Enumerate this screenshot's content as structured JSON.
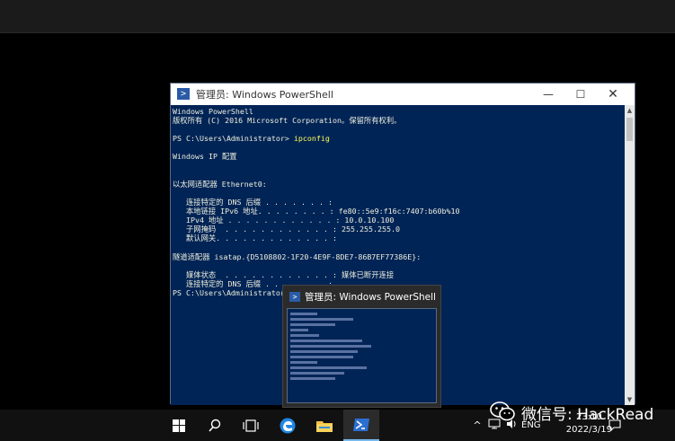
{
  "window": {
    "title": "管理员: Windows PowerShell",
    "minimize": "—",
    "maximize": "☐",
    "close": "✕",
    "icon": "powershell-icon"
  },
  "console": {
    "lines": [
      "Windows PowerShell",
      "版权所有 (C) 2016 Microsoft Corporation。保留所有权利。",
      "",
      "PS C:\\Users\\Administrator> ",
      "",
      "Windows IP 配置",
      "",
      "",
      "以太网适配器 Ethernet0:",
      "",
      "   连接特定的 DNS 后缀 . . . . . . . :",
      "   本地链接 IPv6 地址. . . . . . . . : fe80::5e9:f16c:7407:b60b%10",
      "   IPv4 地址 . . . . . . . . . . . . : 10.0.10.100",
      "   子网掩码  . . . . . . . . . . . . : 255.255.255.0",
      "   默认网关. . . . . . . . . . . . . :",
      "",
      "隧道适配器 isatap.{D5108802-1F20-4E9F-8DE7-86B7EF77386E}:",
      "",
      "   媒体状态  . . . . . . . . . . . . : 媒体已断开连接",
      "   连接特定的 DNS 后缀 . . . . . . . :",
      "PS C:\\Users\\Administrator>"
    ],
    "command": "ipconfig"
  },
  "taskbar": {
    "icons": [
      "windows-start-icon",
      "search-icon",
      "task-view-icon",
      "edge-icon",
      "file-explorer-icon",
      "powershell-icon"
    ],
    "language": "ENG",
    "time": "23:10",
    "date": "2022/3/19"
  },
  "thumbnail": {
    "title": "管理员: Windows PowerShell"
  },
  "watermark": {
    "text": "微信号: HackRead"
  },
  "colors": {
    "console_bg": "#012456",
    "console_fg": "#eeeedd",
    "command": "#ffff55",
    "taskbar_bg": "#111111"
  }
}
